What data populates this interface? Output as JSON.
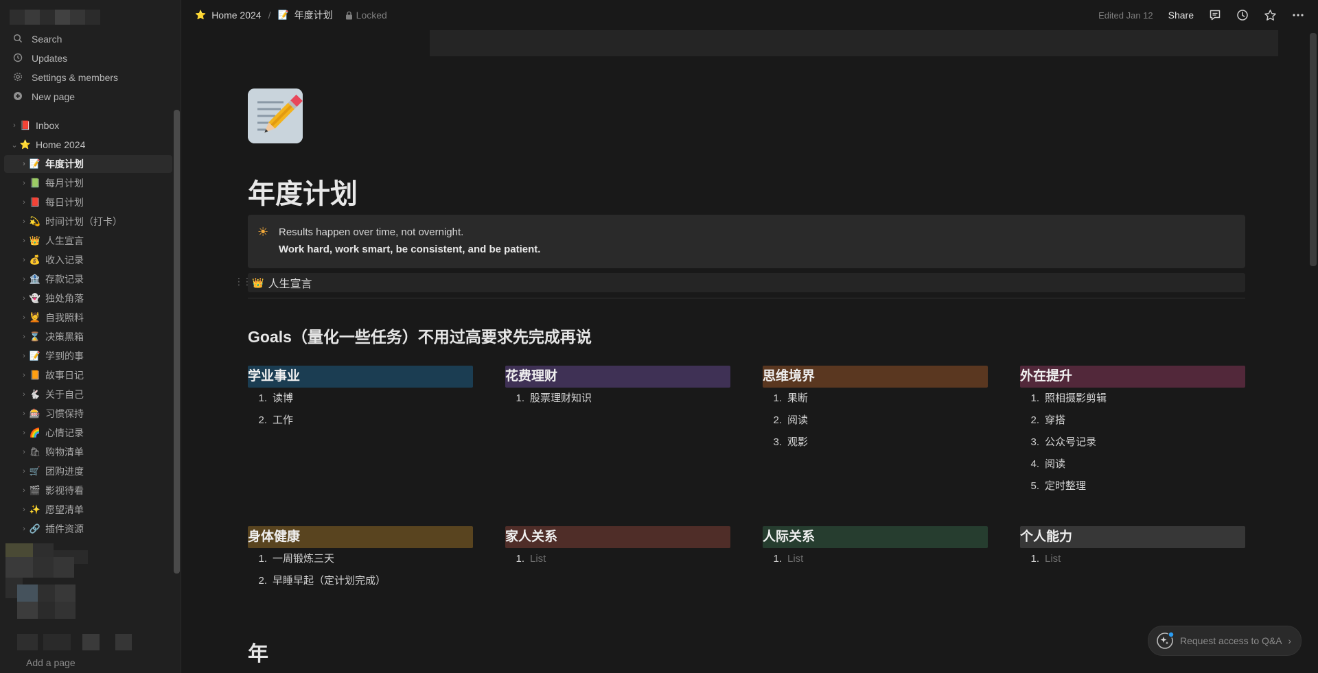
{
  "sidebar": {
    "top_items": [
      {
        "label": "Search",
        "icon": "search-icon"
      },
      {
        "label": "Updates",
        "icon": "clock-icon"
      },
      {
        "label": "Settings & members",
        "icon": "gear-icon"
      },
      {
        "label": "New page",
        "icon": "plus-circle-icon"
      }
    ],
    "tree": [
      {
        "label": "Inbox",
        "emoji": "📕",
        "level": 1
      },
      {
        "label": "Home 2024",
        "emoji": "⭐",
        "level": 1,
        "expanded": true
      },
      {
        "label": "年度计划",
        "emoji": "📝",
        "level": 2,
        "active": true
      },
      {
        "label": "每月计划",
        "emoji": "📗",
        "level": 2
      },
      {
        "label": "每日计划",
        "emoji": "📕",
        "level": 2
      },
      {
        "label": "时间计划（打卡）",
        "emoji": "💫",
        "level": 2
      },
      {
        "label": "人生宣言",
        "emoji": "👑",
        "level": 2
      },
      {
        "label": "收入记录",
        "emoji": "💰",
        "level": 2
      },
      {
        "label": "存款记录",
        "emoji": "🏦",
        "level": 2
      },
      {
        "label": "独处角落",
        "emoji": "👻",
        "level": 2
      },
      {
        "label": "自我照料",
        "emoji": "💆",
        "level": 2
      },
      {
        "label": "决策黑箱",
        "emoji": "⌛",
        "level": 2
      },
      {
        "label": "学到的事",
        "emoji": "📝",
        "level": 2
      },
      {
        "label": "故事日记",
        "emoji": "📙",
        "level": 2
      },
      {
        "label": "关于自己",
        "emoji": "🐇",
        "level": 2
      },
      {
        "label": "习惯保持",
        "emoji": "🎰",
        "level": 2
      },
      {
        "label": "心情记录",
        "emoji": "🌈",
        "level": 2
      },
      {
        "label": "购物清单",
        "emoji": "🛍",
        "level": 2
      },
      {
        "label": "团购进度",
        "emoji": "🛒",
        "level": 2
      },
      {
        "label": "影视待看",
        "emoji": "🎬",
        "level": 2
      },
      {
        "label": "愿望清单",
        "emoji": "✨",
        "level": 2
      },
      {
        "label": "插件资源",
        "emoji": "🔗",
        "level": 2
      }
    ],
    "add_page": "Add a page"
  },
  "topbar": {
    "crumb_home": "Home 2024",
    "crumb_home_emoji": "⭐",
    "crumb_sep": "/",
    "crumb_page": "年度计划",
    "crumb_page_emoji": "📝",
    "locked": "Locked",
    "edited": "Edited Jan 12",
    "share": "Share"
  },
  "page": {
    "title": "年度计划",
    "callout_icon": "☀",
    "callout_line1": "Results happen over time, not overnight.",
    "callout_line2": "Work hard, work smart, be consistent, and be patient.",
    "toggle_emoji": "👑",
    "toggle_label": "人生宣言",
    "goals_title": "Goals（量化一些任务）不用过高要求先完成再说",
    "goal_groups": [
      {
        "title": "学业事业",
        "color": "#1b3d52",
        "items": [
          "读博",
          "工作"
        ],
        "placeholder": false
      },
      {
        "title": "花费理财",
        "color": "#3f3155",
        "items": [
          "股票理财知识"
        ],
        "placeholder": false
      },
      {
        "title": "思维境界",
        "color": "#5a3720",
        "items": [
          "果断",
          "阅读",
          "观影"
        ],
        "placeholder": false
      },
      {
        "title": "外在提升",
        "color": "#52283a",
        "items": [
          "照相摄影剪辑",
          "穿搭",
          "公众号记录",
          "阅读",
          "定时整理"
        ],
        "placeholder": false
      },
      {
        "title": "身体健康",
        "color": "#59441f",
        "items": [
          "一周锻炼三天",
          "早睡早起（定计划完成）"
        ],
        "placeholder": false
      },
      {
        "title": "家人关系",
        "color": "#4f2d28",
        "items": [
          "List"
        ],
        "placeholder": true
      },
      {
        "title": "人际关系",
        "color": "#263d2f",
        "items": [
          "List"
        ],
        "placeholder": true
      },
      {
        "title": "个人能力",
        "color": "#373737",
        "items": [
          "List"
        ],
        "placeholder": true
      }
    ],
    "year_heading": "年"
  },
  "qa_button": {
    "label": "Request access to Q&A",
    "arrow": "›"
  }
}
